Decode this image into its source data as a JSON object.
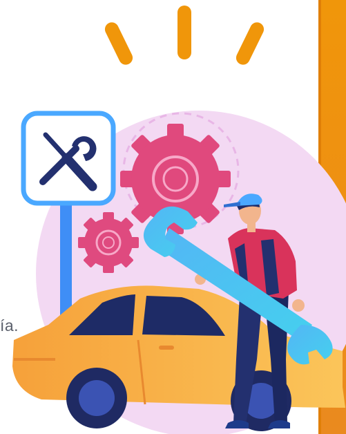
{
  "text_fragment": "ía.",
  "illustration": {
    "subject": "mechanic-holding-giant-wrench-next-to-car",
    "icons": [
      "tools-sign-icon",
      "gear-icon",
      "wrench-icon",
      "car-icon",
      "light-burst-icon"
    ]
  },
  "colors": {
    "accent_orange": "#f0960a",
    "sign_border_blue": "#4aa8ff",
    "wrench_blue": "#4cc3f2",
    "gear_pink": "#e0497d",
    "car_yellow": "#f6b23e",
    "circle_pink": "#f3d9f3",
    "mechanic_navy": "#23306f",
    "shirt_red": "#d9335b"
  }
}
